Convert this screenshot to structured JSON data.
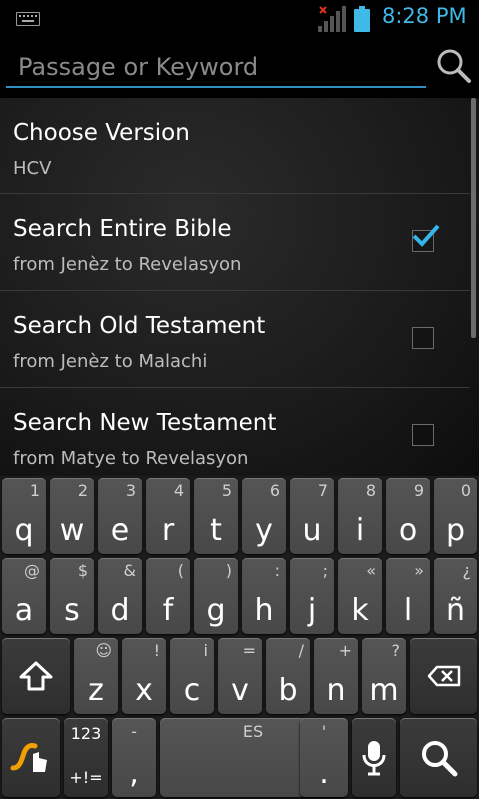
{
  "status_bar": {
    "time": "8:28 PM",
    "accent_color": "#3fb9e6"
  },
  "search": {
    "placeholder": "Passage or Keyword",
    "value": ""
  },
  "options": [
    {
      "title": "Choose Version",
      "subtitle": "HCV"
    },
    {
      "title": "Search Entire Bible",
      "subtitle": "from Jenèz to Revelasyon",
      "checked": true
    },
    {
      "title": "Search Old Testament",
      "subtitle": "from Jenèz to Malachi",
      "checked": false
    },
    {
      "title": "Search New Testament",
      "subtitle": "from Matye to Revelasyon",
      "checked": false
    }
  ],
  "keyboard": {
    "row1": [
      {
        "main": "q",
        "hint": "1"
      },
      {
        "main": "w",
        "hint": "2"
      },
      {
        "main": "e",
        "hint": "3"
      },
      {
        "main": "r",
        "hint": "4"
      },
      {
        "main": "t",
        "hint": "5"
      },
      {
        "main": "y",
        "hint": "6"
      },
      {
        "main": "u",
        "hint": "7"
      },
      {
        "main": "i",
        "hint": "8"
      },
      {
        "main": "o",
        "hint": "9"
      },
      {
        "main": "p",
        "hint": "0"
      }
    ],
    "row2": [
      {
        "main": "a",
        "hint": "@"
      },
      {
        "main": "s",
        "hint": "$"
      },
      {
        "main": "d",
        "hint": "&"
      },
      {
        "main": "f",
        "hint": "("
      },
      {
        "main": "g",
        "hint": ")"
      },
      {
        "main": "h",
        "hint": ":"
      },
      {
        "main": "j",
        "hint": ";"
      },
      {
        "main": "k",
        "hint": "«"
      },
      {
        "main": "l",
        "hint": "»"
      },
      {
        "main": "ñ",
        "hint": "¿"
      }
    ],
    "row3": [
      {
        "main": "z",
        "hint": "☺"
      },
      {
        "main": "x",
        "hint": "!"
      },
      {
        "main": "c",
        "hint": "i"
      },
      {
        "main": "v",
        "hint": "="
      },
      {
        "main": "b",
        "hint": "/"
      },
      {
        "main": "n",
        "hint": "+"
      },
      {
        "main": "m",
        "hint": "?"
      }
    ],
    "symbols_top": "123",
    "symbols_bottom": "+!=",
    "comma_main": ",",
    "comma_hint": "-",
    "space_label": "ES",
    "period_main": ".",
    "period_hint": "'"
  }
}
